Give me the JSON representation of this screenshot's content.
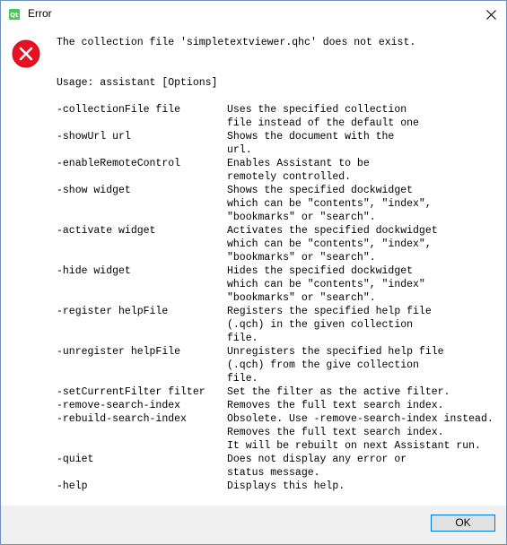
{
  "window": {
    "title": "Error",
    "close_glyph": "✕"
  },
  "icons": {
    "app": "qt-app-icon",
    "error": "error-icon",
    "close": "close-icon"
  },
  "colors": {
    "error_red": "#e81123",
    "accent": "#0078d7"
  },
  "message": {
    "headline": "The collection file 'simpletextviewer.qhc' does not exist.",
    "usage": "Usage: assistant [Options]",
    "options": [
      {
        "option": "-collectionFile file",
        "desc": [
          "Uses the specified collection",
          "file instead of the default one"
        ]
      },
      {
        "option": "-showUrl url",
        "desc": [
          "Shows the document with the",
          "url."
        ]
      },
      {
        "option": "-enableRemoteControl",
        "desc": [
          "Enables Assistant to be",
          "remotely controlled."
        ]
      },
      {
        "option": "-show widget",
        "desc": [
          "Shows the specified dockwidget",
          "which can be \"contents\", \"index\",",
          "\"bookmarks\" or \"search\"."
        ]
      },
      {
        "option": "-activate widget",
        "desc": [
          "Activates the specified dockwidget",
          "which can be \"contents\", \"index\",",
          "\"bookmarks\" or \"search\"."
        ]
      },
      {
        "option": "-hide widget",
        "desc": [
          "Hides the specified dockwidget",
          "which can be \"contents\", \"index\"",
          "\"bookmarks\" or \"search\"."
        ]
      },
      {
        "option": "-register helpFile",
        "desc": [
          "Registers the specified help file",
          "(.qch) in the given collection",
          "file."
        ]
      },
      {
        "option": "-unregister helpFile",
        "desc": [
          "Unregisters the specified help file",
          "(.qch) from the give collection",
          "file."
        ]
      },
      {
        "option": "-setCurrentFilter filter",
        "desc": [
          "Set the filter as the active filter."
        ]
      },
      {
        "option": "-remove-search-index",
        "desc": [
          "Removes the full text search index."
        ]
      },
      {
        "option": "-rebuild-search-index",
        "desc": [
          "Obsolete. Use -remove-search-index instead.",
          "Removes the full text search index.",
          "It will be rebuilt on next Assistant run."
        ]
      },
      {
        "option": "-quiet",
        "desc": [
          "Does not display any error or",
          "status message."
        ]
      },
      {
        "option": "-help",
        "desc": [
          "Displays this help."
        ]
      }
    ]
  },
  "footer": {
    "ok_label": "OK"
  }
}
